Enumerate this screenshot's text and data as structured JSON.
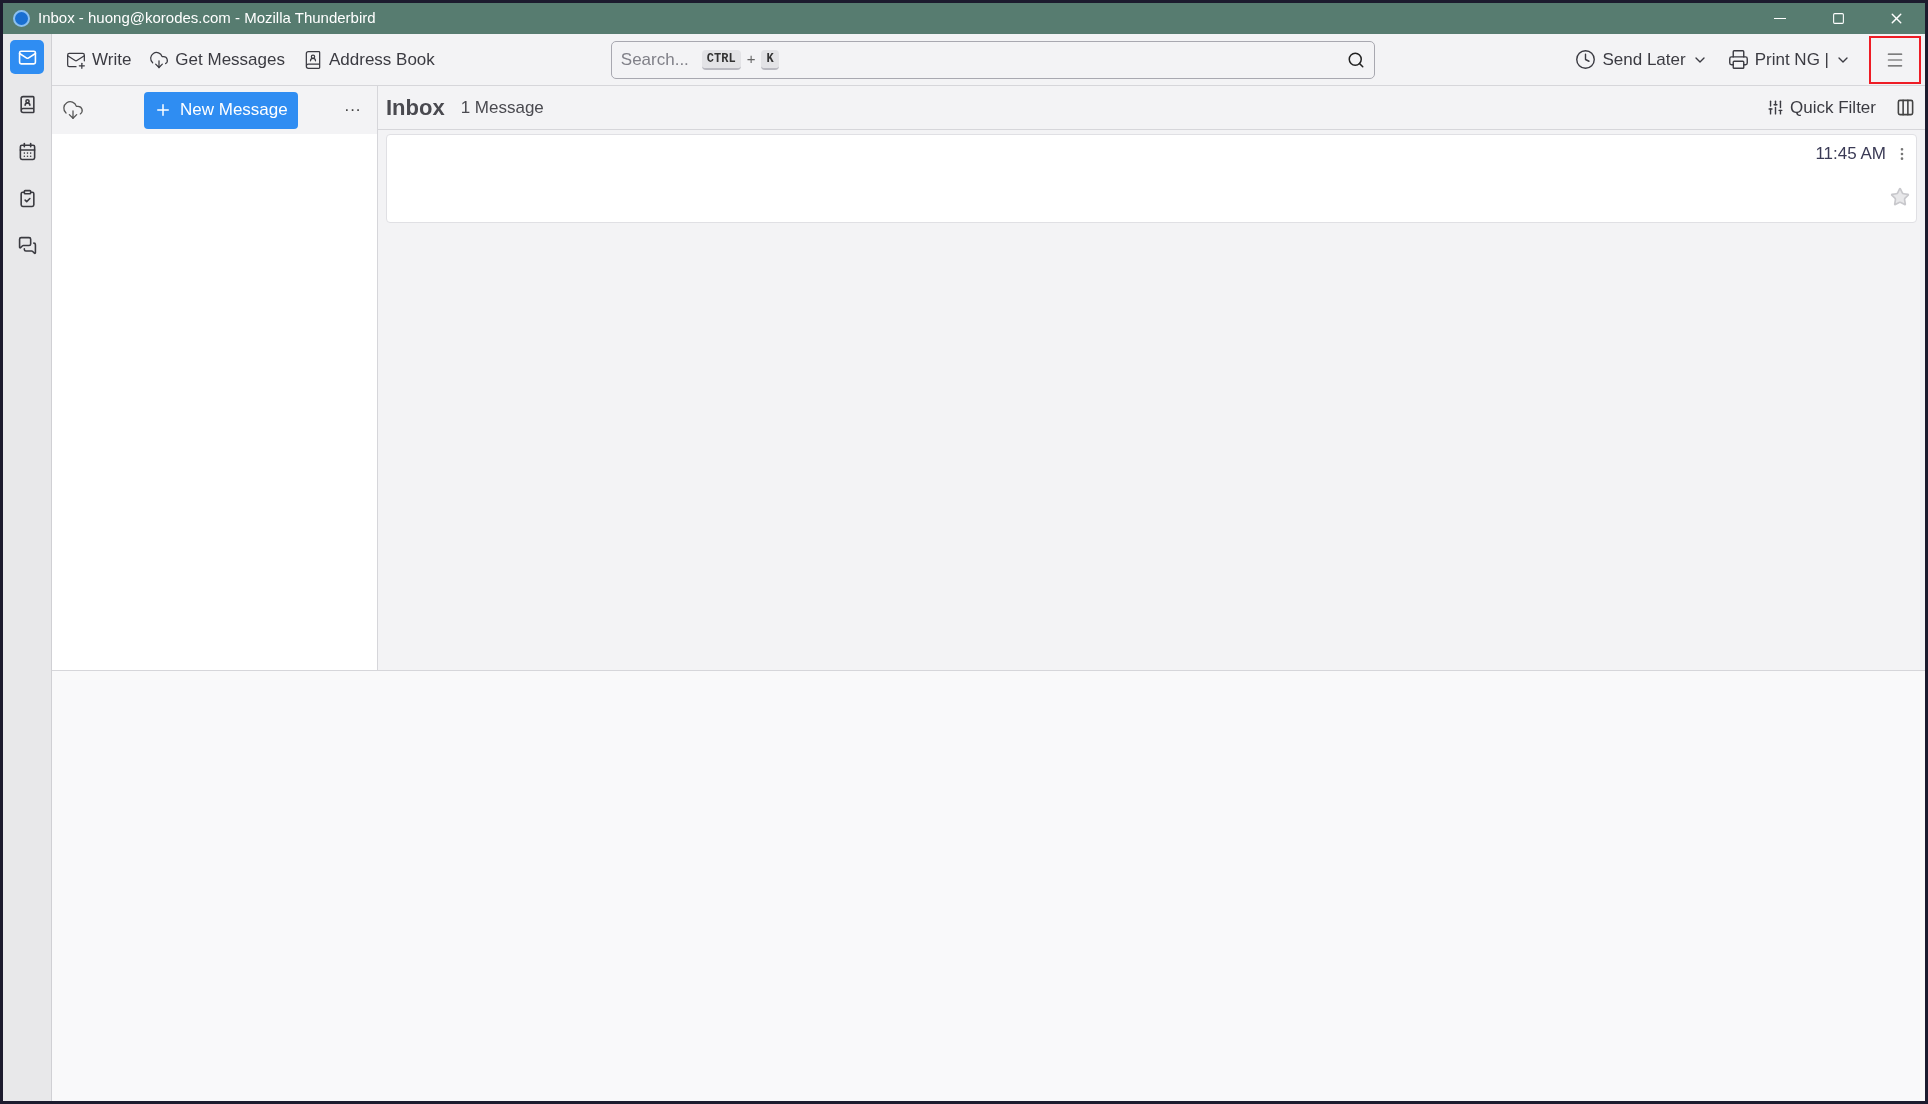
{
  "window": {
    "title": "Inbox - huong@korodes.com - Mozilla Thunderbird"
  },
  "spaces": [
    {
      "kind": "mail",
      "selected": true
    },
    {
      "kind": "contacts",
      "selected": false
    },
    {
      "kind": "calendar",
      "selected": false
    },
    {
      "kind": "tasks",
      "selected": false
    },
    {
      "kind": "chat",
      "selected": false
    }
  ],
  "toolbar": {
    "left": [
      {
        "kind": "write",
        "label": "Write"
      },
      {
        "kind": "get",
        "label": "Get Messages"
      },
      {
        "kind": "book",
        "label": "Address Book"
      }
    ],
    "search": {
      "placeholder": "Search...",
      "keys": [
        "CTRL",
        "+",
        "K"
      ]
    },
    "right": [
      {
        "kind": "clock",
        "label": "Send Later"
      },
      {
        "kind": "printer",
        "label": "Print NG |"
      }
    ]
  },
  "folder_pane": {
    "new_message": "New Message",
    "more": "···"
  },
  "message_list": {
    "title": "Inbox",
    "count": "1 Message",
    "quick_filter": "Quick Filter",
    "messages": [
      {
        "time": "11:45 AM",
        "starred": false
      }
    ]
  }
}
